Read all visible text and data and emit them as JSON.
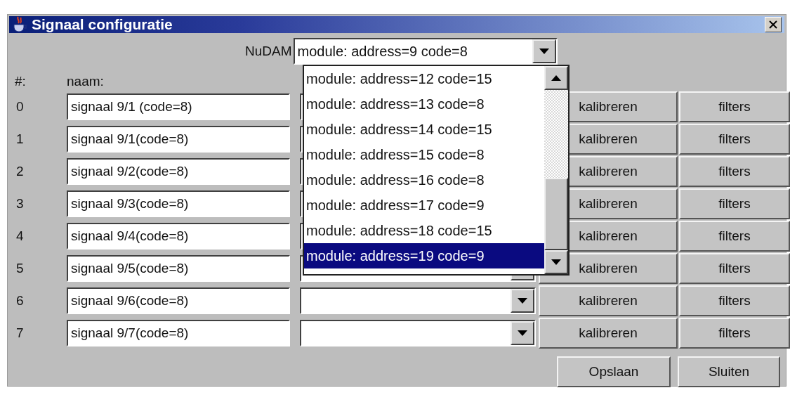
{
  "window": {
    "title": "Signaal configuratie"
  },
  "module_selector": {
    "label": "NuDAM",
    "value": "module: address=9 code=8"
  },
  "module_list": [
    {
      "label": "module: address=12 code=15",
      "selected": false
    },
    {
      "label": "module: address=13 code=8",
      "selected": false
    },
    {
      "label": "module: address=14 code=15",
      "selected": false
    },
    {
      "label": "module: address=15 code=8",
      "selected": false
    },
    {
      "label": "module: address=16 code=8",
      "selected": false
    },
    {
      "label": "module: address=17 code=9",
      "selected": false
    },
    {
      "label": "module: address=18 code=15",
      "selected": false
    },
    {
      "label": "module: address=19 code=9",
      "selected": true
    }
  ],
  "columns": {
    "index": "#:",
    "name": "naam:"
  },
  "rows": [
    {
      "index": "0",
      "name": "signaal 9/1 (code=8)",
      "calibrate": "kalibreren",
      "filters": "filters"
    },
    {
      "index": "1",
      "name": "signaal 9/1(code=8)",
      "calibrate": "kalibreren",
      "filters": "filters"
    },
    {
      "index": "2",
      "name": "signaal 9/2(code=8)",
      "calibrate": "kalibreren",
      "filters": "filters"
    },
    {
      "index": "3",
      "name": "signaal 9/3(code=8)",
      "calibrate": "kalibreren",
      "filters": "filters"
    },
    {
      "index": "4",
      "name": "signaal 9/4(code=8)",
      "calibrate": "kalibreren",
      "filters": "filters"
    },
    {
      "index": "5",
      "name": "signaal 9/5(code=8)",
      "calibrate": "kalibreren",
      "filters": "filters"
    },
    {
      "index": "6",
      "name": "signaal 9/6(code=8)",
      "calibrate": "kalibreren",
      "filters": "filters"
    },
    {
      "index": "7",
      "name": "signaal 9/7(code=8)",
      "calibrate": "kalibreren",
      "filters": "filters"
    }
  ],
  "buttons": [
    "Opslaan",
    "Sluiten"
  ]
}
